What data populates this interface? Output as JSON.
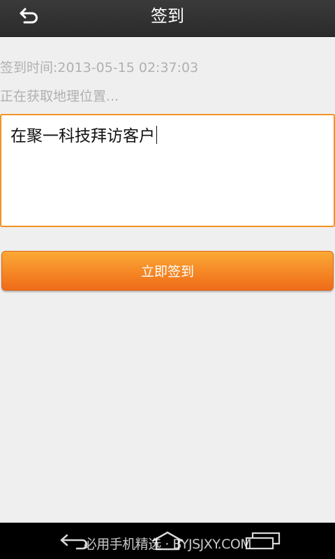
{
  "header": {
    "title": "签到",
    "back_icon": "back-arrow-icon"
  },
  "checkin": {
    "time_text": "签到时间:2013-05-15 02:37:03",
    "location_status": "正在获取地理位置...",
    "note_value": "在聚一科技拜访客户",
    "submit_label": "立即签到"
  },
  "navbar": {
    "back_icon": "nav-back-icon",
    "home_icon": "nav-home-icon",
    "recent_icon": "nav-recent-apps-icon"
  },
  "watermark": "必用手机精选 · BYJSJXY.COM",
  "colors": {
    "accent_orange": "#f39322",
    "button_top": "#fba935",
    "button_bottom": "#ef6b18",
    "titlebar": "#2f2f2f",
    "muted_text": "#b0b0b0",
    "background": "#efefef"
  }
}
